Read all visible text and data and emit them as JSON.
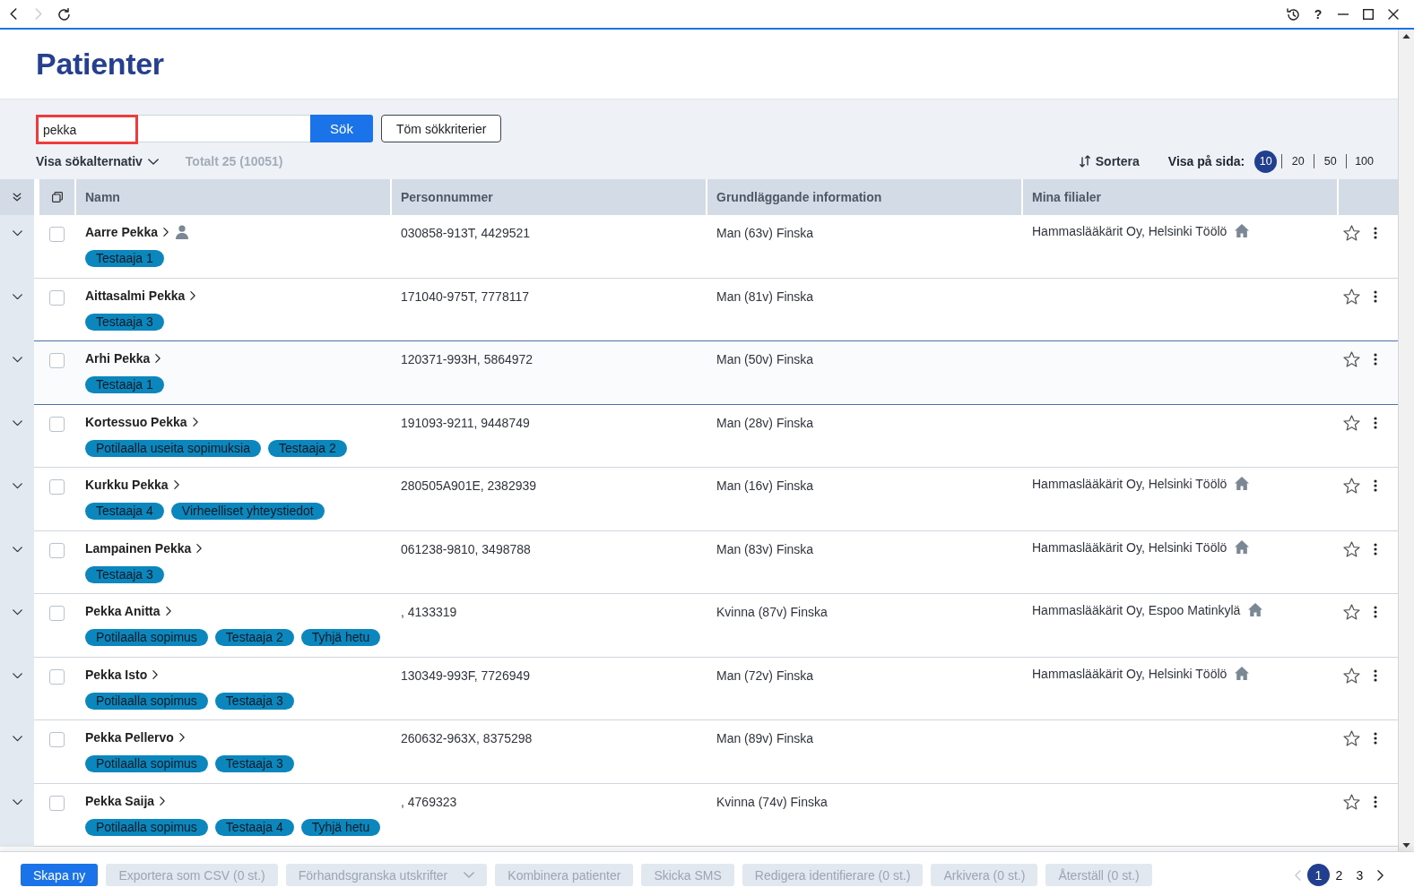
{
  "browser": {
    "nav": [
      {
        "kind": "back",
        "disabled": false
      },
      {
        "kind": "forward",
        "disabled": true
      },
      {
        "kind": "reload",
        "disabled": false
      }
    ],
    "window_controls": [
      {
        "kind": "history"
      },
      {
        "kind": "help",
        "label": "?"
      },
      {
        "kind": "minimize"
      },
      {
        "kind": "maximize"
      },
      {
        "kind": "close"
      }
    ]
  },
  "page": {
    "title": "Patienter"
  },
  "search": {
    "value": "pekka",
    "highlighted": true,
    "submit": "Sök",
    "clear": "Töm sökkriterier",
    "options_toggle": "Visa sökalternativ",
    "total": "Totalt 25 (10051)",
    "sort": "Sortera",
    "page_size_label": "Visa på sida:",
    "page_sizes": [
      {
        "label": "10",
        "selected": true
      },
      {
        "label": "20",
        "selected": false
      },
      {
        "label": "50",
        "selected": false
      },
      {
        "label": "100",
        "selected": false
      }
    ]
  },
  "table": {
    "columns": [
      "Namn",
      "Personnummer",
      "Grundläggande information",
      "Mina filialer"
    ],
    "rows": [
      {
        "expanded": false,
        "checked": false,
        "hovered": false,
        "name": "Aarre Pekka",
        "user_icon": true,
        "tags": [
          "Testaaja 1"
        ],
        "personnummer": "030858-913T, 4429521",
        "info": "Man (63v) Finska",
        "branch": "Hammaslääkärit Oy, Helsinki Töölö",
        "favorite": false
      },
      {
        "expanded": false,
        "checked": false,
        "hovered": false,
        "name": "Aittasalmi Pekka",
        "user_icon": false,
        "tags": [
          "Testaaja 3"
        ],
        "personnummer": "171040-975T, 7778117",
        "info": "Man (81v) Finska",
        "favorite": false
      },
      {
        "expanded": false,
        "checked": false,
        "hovered": true,
        "name": "Arhi Pekka",
        "user_icon": false,
        "tags": [
          "Testaaja 1"
        ],
        "personnummer": "120371-993H, 5864972",
        "info": "Man (50v) Finska",
        "favorite": false
      },
      {
        "expanded": false,
        "checked": false,
        "hovered": false,
        "name": "Kortessuo Pekka",
        "user_icon": false,
        "tags": [
          "Potilaalla useita sopimuksia",
          "Testaaja 2"
        ],
        "personnummer": "191093-9211, 9448749",
        "info": "Man (28v) Finska",
        "favorite": false
      },
      {
        "expanded": false,
        "checked": false,
        "hovered": false,
        "name": "Kurkku Pekka",
        "user_icon": false,
        "tags": [
          "Testaaja 4",
          "Virheelliset yhteystiedot"
        ],
        "personnummer": "280505A901E, 2382939",
        "info": "Man (16v) Finska",
        "branch": "Hammaslääkärit Oy, Helsinki Töölö",
        "favorite": false
      },
      {
        "expanded": false,
        "checked": false,
        "hovered": false,
        "name": "Lampainen Pekka",
        "user_icon": false,
        "tags": [
          "Testaaja 3"
        ],
        "personnummer": "061238-9810, 3498788",
        "info": "Man (83v) Finska",
        "branch": "Hammaslääkärit Oy, Helsinki Töölö",
        "favorite": false
      },
      {
        "expanded": false,
        "checked": false,
        "hovered": false,
        "name": "Pekka Anitta",
        "user_icon": false,
        "tags": [
          "Potilaalla sopimus",
          "Testaaja 2",
          "Tyhjä hetu"
        ],
        "personnummer": ", 4133319",
        "info": "Kvinna (87v) Finska",
        "branch": "Hammaslääkärit Oy, Espoo Matinkylä",
        "favorite": false
      },
      {
        "expanded": false,
        "checked": false,
        "hovered": false,
        "name": "Pekka Isto",
        "user_icon": false,
        "tags": [
          "Potilaalla sopimus",
          "Testaaja 3"
        ],
        "personnummer": "130349-993F, 7726949",
        "info": "Man (72v) Finska",
        "branch": "Hammaslääkärit Oy, Helsinki Töölö",
        "favorite": false
      },
      {
        "expanded": false,
        "checked": false,
        "hovered": false,
        "name": "Pekka Pellervo",
        "user_icon": false,
        "tags": [
          "Potilaalla sopimus",
          "Testaaja 3"
        ],
        "personnummer": "260632-963X, 8375298",
        "info": "Man (89v) Finska",
        "favorite": false
      },
      {
        "expanded": false,
        "checked": false,
        "hovered": false,
        "name": "Pekka Saija",
        "user_icon": false,
        "tags": [
          "Potilaalla sopimus",
          "Testaaja 4",
          "Tyhjä hetu"
        ],
        "personnummer": ", 4769323",
        "info": "Kvinna (74v) Finska",
        "favorite": false
      }
    ]
  },
  "actions": [
    {
      "kind": "primary",
      "label": "Skapa ny",
      "disabled": false
    },
    {
      "kind": "button",
      "label": "Exportera som CSV (0 st.)",
      "disabled": true
    },
    {
      "kind": "dropdown",
      "label": "Förhandsgranska utskrifter",
      "disabled": true
    },
    {
      "kind": "button",
      "label": "Kombinera patienter",
      "disabled": true
    },
    {
      "kind": "button",
      "label": "Skicka SMS",
      "disabled": true
    },
    {
      "kind": "button",
      "label": "Redigera identifierare (0 st.)",
      "disabled": true
    },
    {
      "kind": "button",
      "label": "Arkivera (0 st.)",
      "disabled": true
    },
    {
      "kind": "button",
      "label": "Återställ (0 st.)",
      "disabled": true
    }
  ],
  "pagination": {
    "prev_disabled": true,
    "next_disabled": false,
    "pages": [
      {
        "label": "1",
        "selected": true
      },
      {
        "label": "2",
        "selected": false
      },
      {
        "label": "3",
        "selected": false
      }
    ]
  }
}
